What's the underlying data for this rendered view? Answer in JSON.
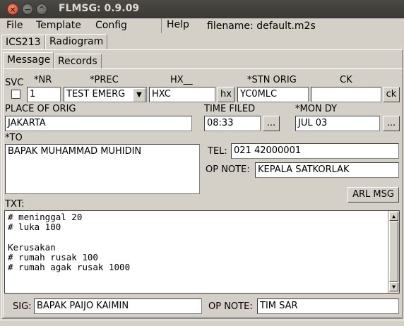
{
  "window": {
    "title": "FLMSG: 0.9.09"
  },
  "menu": {
    "file": "File",
    "template": "Template",
    "config": "Config",
    "help": "Help"
  },
  "filename": "filename: default.m2s",
  "tabs": {
    "ics213": "ICS213",
    "radiogram": "Radiogram"
  },
  "subtabs": {
    "message": "Message",
    "records": "Records"
  },
  "labels": {
    "svc": "SVC",
    "nr": "*NR",
    "prec": "*PREC",
    "hx": "HX__",
    "stn_orig": "*STN ORIG",
    "ck": "CK",
    "place_of_orig": "PLACE OF ORIG",
    "time_filed": "TIME FILED",
    "mon_dy": "*MON DY",
    "to": "*TO",
    "tel": "TEL:",
    "op_note": "OP NOTE:",
    "txt": "TXT:",
    "sig": "SIG:",
    "op_note2": "OP NOTE:"
  },
  "values": {
    "nr": "1",
    "prec": "TEST EMERG",
    "hx": "HXC",
    "stn_orig": "YC0MLC",
    "ck": "",
    "place_of_orig": "JAKARTA",
    "time_filed": "08:33",
    "mon_dy": "JUL 03",
    "to": "BAPAK MUHAMMAD MUHIDIN",
    "tel": "021 42000001",
    "op_note": "KEPALA SATKORLAK",
    "sig": "BAPAK PAIJO KAIMIN",
    "op_note2": "TIM SAR"
  },
  "buttons": {
    "hx": "hx",
    "ck": "ck",
    "time_more": "...",
    "date_more": "...",
    "arl": "ARL MSG"
  },
  "txt_lines": [
    "# meninggal 20",
    "# luka 100",
    "",
    "Kerusakan",
    "# rumah rusak 100",
    "# rumah agak rusak 1000"
  ]
}
